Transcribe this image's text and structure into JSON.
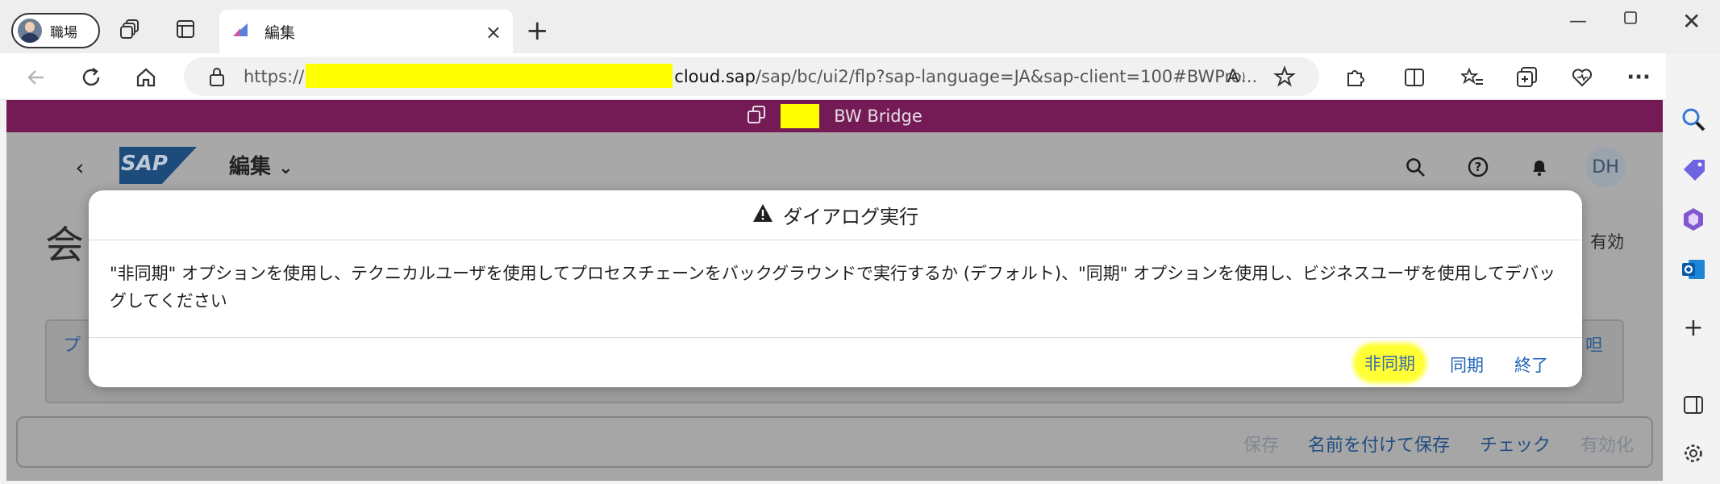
{
  "browser": {
    "profile_label": "職場",
    "tab_title": "編集",
    "url_prefix": "https://",
    "url_domain": "cloud.sap",
    "url_rest": "/sap/bc/ui2/flp?sap-language=JA&sap-client=100#BWPro..."
  },
  "page": {
    "banner_text": "BW Bridge",
    "shell_title": "編集",
    "user_initials": "DH",
    "obj_title_partial": "会",
    "obj_status_partial": "有効",
    "card_tab_left_partial": "プ",
    "card_tab_right_partial": "呾"
  },
  "footer": {
    "save": "保存",
    "save_as": "名前を付けて保存",
    "check": "チェック",
    "activate": "有効化"
  },
  "dialog": {
    "title": "ダイアログ実行",
    "message": "\"非同期\" オプションを使用し、テクニカルユーザを使用してプロセスチェーンをバックグラウンドで実行するか (デフォルト)、\"同期\" オプションを使用し、ビジネスユーザを使用してデバッグしてください",
    "btn_async": "非同期",
    "btn_sync": "同期",
    "btn_close": "終了"
  },
  "colors": {
    "banner": "#741b56",
    "highlight": "#ffff00",
    "link": "#1d63b4"
  }
}
